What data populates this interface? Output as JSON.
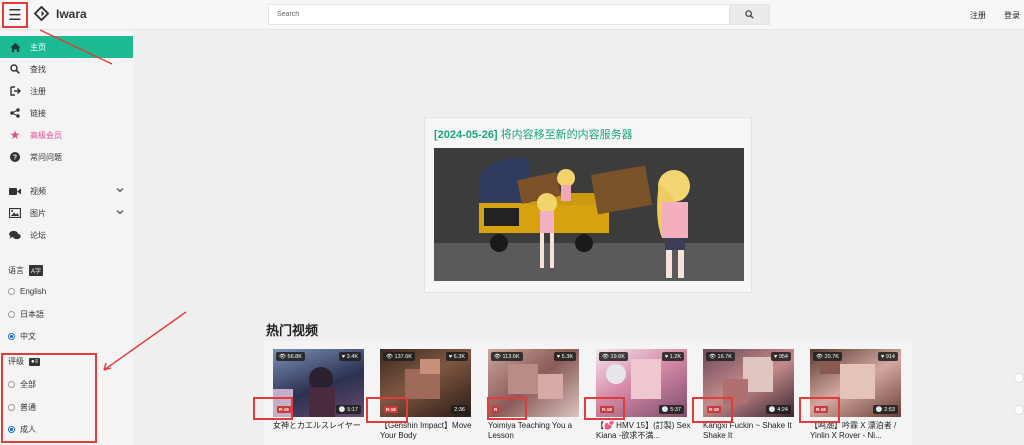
{
  "app": {
    "logo_text": "Iwara"
  },
  "search": {
    "placeholder": "Search"
  },
  "header": {
    "register": "注册",
    "login": "登录"
  },
  "nav": {
    "home": "主页",
    "search": "查找",
    "register": "注册",
    "links": "链接",
    "premium": "高级会员",
    "faq": "常问问题",
    "videos": "视频",
    "images": "图片",
    "forum": "论坛"
  },
  "language": {
    "label": "语言",
    "options": [
      "English",
      "日本語",
      "中文"
    ],
    "selected": "中文"
  },
  "rating": {
    "label": "评级",
    "options": [
      "全部",
      "普通",
      "成人"
    ],
    "selected": "成人"
  },
  "announcement": {
    "date": "[2024-05-26]",
    "text": "将内容移至新的内容服务器"
  },
  "popular": {
    "title": "热门视频",
    "videos": [
      {
        "views": "56.8K",
        "likes": "3.4K",
        "duration": "5:17",
        "rating": "R-18",
        "title": "女神とカエルスレイヤー"
      },
      {
        "views": "137.6K",
        "likes": "6.3K",
        "duration": "2:36",
        "rating": "R-18",
        "title": "【Genshin Impact】Move Your Body"
      },
      {
        "views": "113.6K",
        "likes": "5.3K",
        "duration": "",
        "rating": "R",
        "title": "Yoimiya Teaching You a Lesson"
      },
      {
        "views": "19.6K",
        "likes": "1.2K",
        "duration": "5:37",
        "rating": "R-18",
        "title": "【💕 HMV 15】(訂製) Sex Kiana -欲求不満..."
      },
      {
        "views": "16.7K",
        "likes": "954",
        "duration": "4:24",
        "rating": "R-18",
        "title": "Kangxi Fuckin ~ Shake It Shake It"
      },
      {
        "views": "20.7K",
        "likes": "914",
        "duration": "2:53",
        "rating": "R-18",
        "title": "【鸣潮】吟霖 X 漂泊者 / Yinlin X Rover - Ni..."
      }
    ]
  },
  "colors": {
    "accent": "#1dbb94",
    "premium": "#e04b95",
    "annotation": "#e23b3b"
  },
  "icons": {
    "menu": "hamburger-icon",
    "logo": "diamond-logo-icon",
    "search": "magnifier-icon",
    "home": "home-icon",
    "find": "search-icon",
    "register": "sign-in-icon",
    "links": "share-icon",
    "premium": "star-icon",
    "faq": "question-circle-icon",
    "videos": "video-camera-icon",
    "images": "image-icon",
    "forum": "comments-icon",
    "language": "language-badge-icon",
    "rating": "id-card-icon"
  }
}
